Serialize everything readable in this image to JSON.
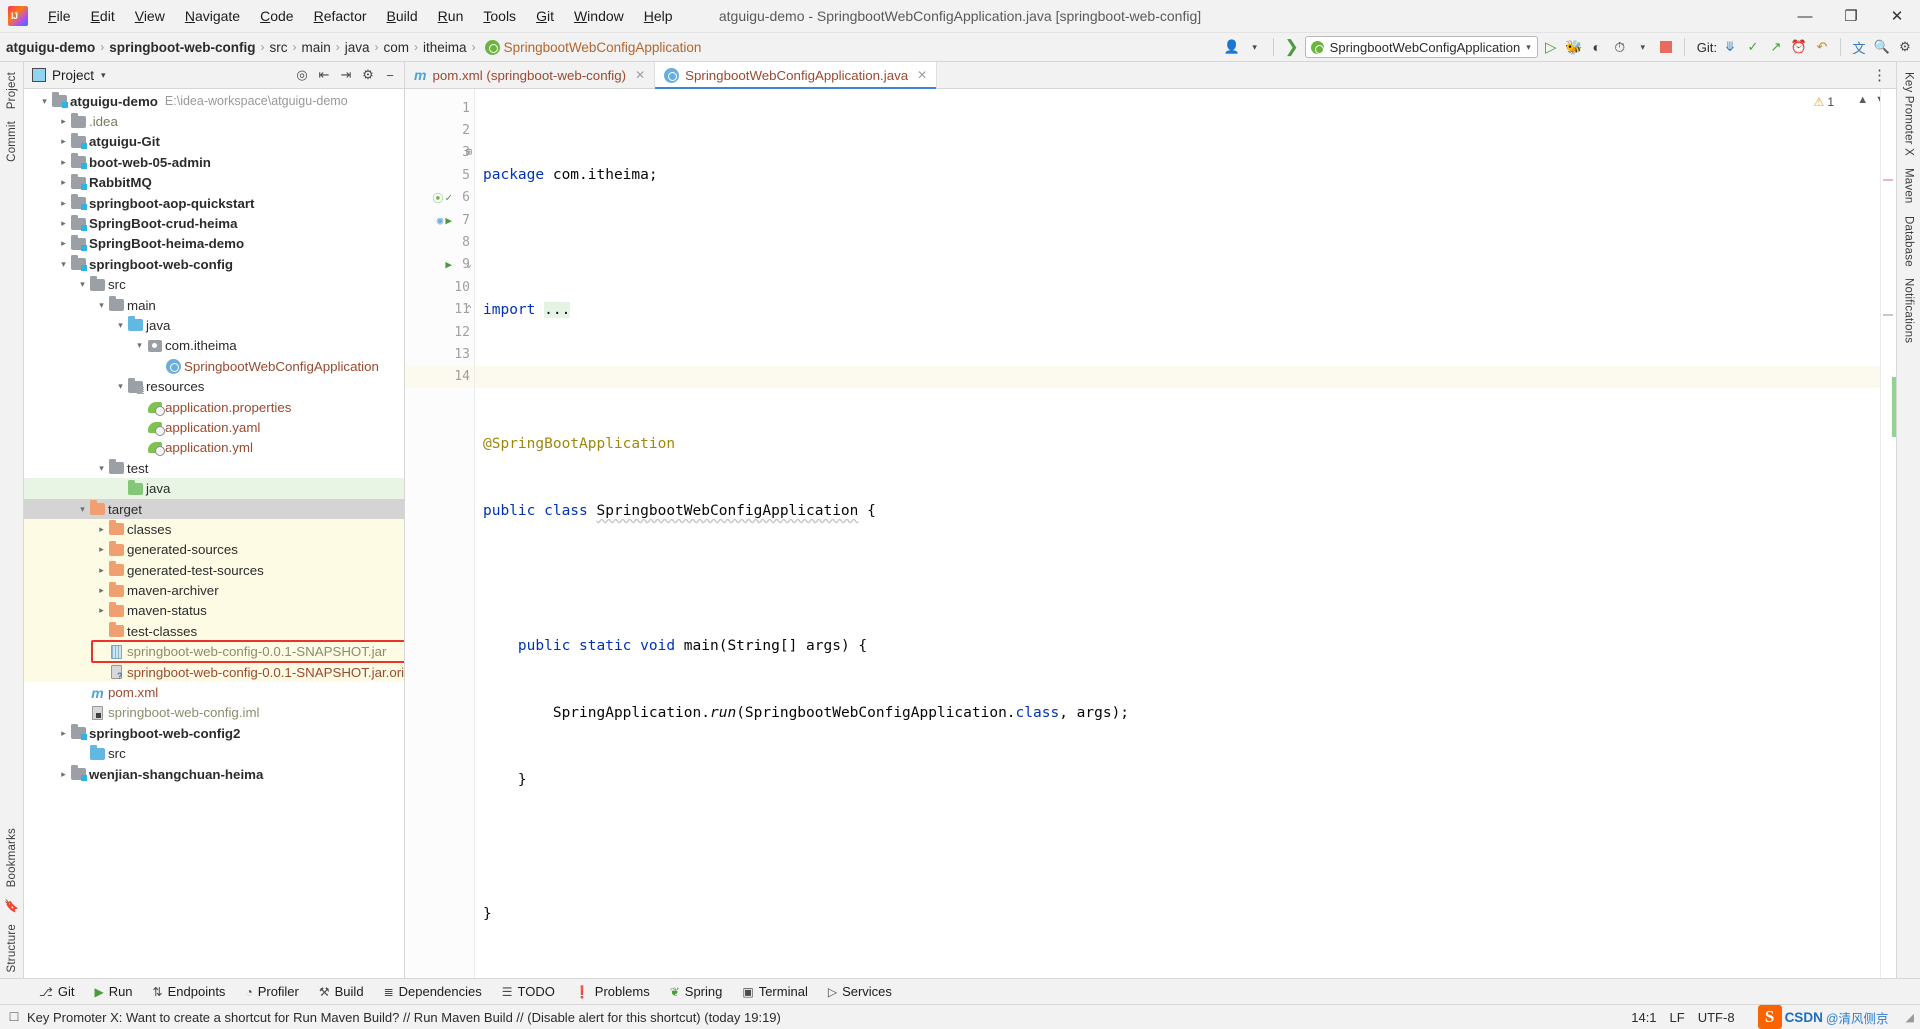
{
  "window": {
    "title": "atguigu-demo - SpringbootWebConfigApplication.java [springboot-web-config]",
    "minimize": "—",
    "maximize": "❐",
    "close": "✕",
    "logo_text": "IJ"
  },
  "menubar": {
    "items": [
      "File",
      "Edit",
      "View",
      "Navigate",
      "Code",
      "Refactor",
      "Build",
      "Run",
      "Tools",
      "Git",
      "Window",
      "Help"
    ]
  },
  "navbar": {
    "breadcrumbs": [
      {
        "label": "atguigu-demo",
        "style": "bold"
      },
      {
        "label": "springboot-web-config",
        "style": "bold"
      },
      {
        "label": "src",
        "style": "normal"
      },
      {
        "label": "main",
        "style": "normal"
      },
      {
        "label": "java",
        "style": "normal"
      },
      {
        "label": "com",
        "style": "normal"
      },
      {
        "label": "itheima",
        "style": "normal"
      },
      {
        "label": "SpringbootWebConfigApplication",
        "style": "link"
      }
    ],
    "separator": "›",
    "run_config": "SpringbootWebConfigApplication",
    "run_config_caret": "▾",
    "git_label": "Git:",
    "icons": {
      "user": "user-icon",
      "build_hammer": "hammer-icon",
      "run": "run-icon",
      "debug": "debug-icon",
      "run_coverage": "coverage-icon",
      "profile": "profiler-icon",
      "stop": "stop-icon",
      "update_project": "update-project-icon",
      "commit": "commit-icon",
      "push": "push-icon",
      "history": "history-icon",
      "rollback": "rollback-icon",
      "translate": "translate-icon",
      "search": "search-icon",
      "settings": "settings-icon"
    }
  },
  "left_rail": {
    "items": [
      "Project",
      "Commit",
      "Bookmarks",
      "Structure"
    ]
  },
  "right_rail": {
    "items": [
      "Key Promoter X",
      "Maven",
      "Database",
      "Notifications"
    ]
  },
  "project_panel": {
    "title": "Project",
    "caret": "▾",
    "actions": [
      "locate-icon",
      "expand-all-icon",
      "collapse-all-icon",
      "settings-icon",
      "hide-icon"
    ],
    "tree": [
      {
        "depth": 0,
        "arrow": "open",
        "icon": "module-folder",
        "label": "atguigu-demo",
        "bold": true,
        "sub": "E:\\idea-workspace\\atguigu-demo"
      },
      {
        "depth": 1,
        "arrow": "closed",
        "icon": "folder-gray",
        "label": ".idea",
        "color": "gray-text"
      },
      {
        "depth": 1,
        "arrow": "closed",
        "icon": "module-folder",
        "label": "atguigu-Git",
        "bold": true
      },
      {
        "depth": 1,
        "arrow": "closed",
        "icon": "module-folder",
        "label": "boot-web-05-admin",
        "bold": true
      },
      {
        "depth": 1,
        "arrow": "closed",
        "icon": "module-folder",
        "label": "RabbitMQ",
        "bold": true
      },
      {
        "depth": 1,
        "arrow": "closed",
        "icon": "module-folder",
        "label": "springboot-aop-quickstart",
        "bold": true
      },
      {
        "depth": 1,
        "arrow": "closed",
        "icon": "module-folder",
        "label": "SpringBoot-crud-heima",
        "bold": true
      },
      {
        "depth": 1,
        "arrow": "closed",
        "icon": "module-folder",
        "label": "SpringBoot-heima-demo",
        "bold": true
      },
      {
        "depth": 1,
        "arrow": "open",
        "icon": "module-folder",
        "label": "springboot-web-config",
        "bold": true
      },
      {
        "depth": 2,
        "arrow": "open",
        "icon": "folder-gray",
        "label": "src"
      },
      {
        "depth": 3,
        "arrow": "open",
        "icon": "folder-gray",
        "label": "main"
      },
      {
        "depth": 4,
        "arrow": "open",
        "icon": "folder-blue",
        "label": "java"
      },
      {
        "depth": 5,
        "arrow": "open",
        "icon": "package",
        "label": "com.itheima"
      },
      {
        "depth": 6,
        "arrow": "none",
        "icon": "spring-class",
        "label": "SpringbootWebConfigApplication",
        "color": "brown"
      },
      {
        "depth": 4,
        "arrow": "open",
        "icon": "folder-res",
        "label": "resources"
      },
      {
        "depth": 5,
        "arrow": "none",
        "icon": "spring-leaf",
        "label": "application.properties",
        "color": "brown"
      },
      {
        "depth": 5,
        "arrow": "none",
        "icon": "spring-leaf",
        "label": "application.yaml",
        "color": "brown"
      },
      {
        "depth": 5,
        "arrow": "none",
        "icon": "spring-leaf",
        "label": "application.yml",
        "color": "brown"
      },
      {
        "depth": 3,
        "arrow": "open",
        "icon": "folder-gray",
        "label": "test"
      },
      {
        "depth": 4,
        "arrow": "none",
        "icon": "folder-green",
        "label": "java",
        "bg": "green"
      },
      {
        "depth": 2,
        "arrow": "open",
        "icon": "folder-orange",
        "label": "target",
        "bg": "selected"
      },
      {
        "depth": 3,
        "arrow": "closed",
        "icon": "folder-orange",
        "label": "classes",
        "bg": "yellow"
      },
      {
        "depth": 3,
        "arrow": "closed",
        "icon": "folder-orange",
        "label": "generated-sources",
        "bg": "yellow"
      },
      {
        "depth": 3,
        "arrow": "closed",
        "icon": "folder-orange",
        "label": "generated-test-sources",
        "bg": "yellow"
      },
      {
        "depth": 3,
        "arrow": "closed",
        "icon": "folder-orange",
        "label": "maven-archiver",
        "bg": "yellow"
      },
      {
        "depth": 3,
        "arrow": "closed",
        "icon": "folder-orange",
        "label": "maven-status",
        "bg": "yellow"
      },
      {
        "depth": 3,
        "arrow": "none",
        "icon": "folder-orange",
        "label": "test-classes",
        "bg": "yellow"
      },
      {
        "depth": 3,
        "arrow": "none",
        "icon": "jar",
        "label": "springboot-web-config-0.0.1-SNAPSHOT.jar",
        "bg": "yellow",
        "color": "gray-olive",
        "highlight": true
      },
      {
        "depth": 3,
        "arrow": "none",
        "icon": "file-question",
        "label": "springboot-web-config-0.0.1-SNAPSHOT.jar.ori",
        "bg": "yellow",
        "color": "brown"
      },
      {
        "depth": 2,
        "arrow": "none",
        "icon": "maven-m",
        "label": "pom.xml",
        "color": "brown"
      },
      {
        "depth": 2,
        "arrow": "none",
        "icon": "iml",
        "label": "springboot-web-config.iml",
        "color": "gray-olive"
      },
      {
        "depth": 1,
        "arrow": "closed",
        "icon": "module-folder",
        "label": "springboot-web-config2",
        "bold": true
      },
      {
        "depth": 2,
        "arrow": "none",
        "icon": "folder-blue",
        "label": "src"
      },
      {
        "depth": 1,
        "arrow": "closed",
        "icon": "module-folder",
        "label": "wenjian-shangchuan-heima",
        "bold": true
      }
    ]
  },
  "editor": {
    "tabs": [
      {
        "label": "pom.xml (springboot-web-config)",
        "icon": "maven-m-icon",
        "active": false,
        "close": "✕"
      },
      {
        "label": "SpringbootWebConfigApplication.java",
        "icon": "spring-class-icon",
        "active": true,
        "close": "✕"
      }
    ],
    "kebab": "⋮",
    "warning_count": "1",
    "warning_icon": "⚠",
    "lines": [
      {
        "no": "1",
        "text": "package com.itheima;"
      },
      {
        "no": "2",
        "text": ""
      },
      {
        "no": "3",
        "text": "import ..."
      },
      {
        "no": "5",
        "text": ""
      },
      {
        "no": "6",
        "text": "@SpringBootApplication"
      },
      {
        "no": "7",
        "text": "public class SpringbootWebConfigApplication {"
      },
      {
        "no": "8",
        "text": ""
      },
      {
        "no": "9",
        "text": "    public static void main(String[] args) {"
      },
      {
        "no": "10",
        "text": "        SpringApplication.run(SpringbootWebConfigApplication.class, args);"
      },
      {
        "no": "11",
        "text": "    }"
      },
      {
        "no": "12",
        "text": ""
      },
      {
        "no": "13",
        "text": "}"
      },
      {
        "no": "14",
        "text": ""
      }
    ]
  },
  "bottom_tabs": [
    {
      "label": "Git",
      "icon": "git-branch-icon"
    },
    {
      "label": "Run",
      "icon": "run-icon"
    },
    {
      "label": "Endpoints",
      "icon": "endpoints-icon"
    },
    {
      "label": "Profiler",
      "icon": "profiler-icon"
    },
    {
      "label": "Build",
      "icon": "hammer-icon"
    },
    {
      "label": "Dependencies",
      "icon": "dependencies-icon"
    },
    {
      "label": "TODO",
      "icon": "todo-icon"
    },
    {
      "label": "Problems",
      "icon": "problems-icon"
    },
    {
      "label": "Spring",
      "icon": "spring-leaf-icon"
    },
    {
      "label": "Terminal",
      "icon": "terminal-icon"
    },
    {
      "label": "Services",
      "icon": "services-icon"
    }
  ],
  "statusbar": {
    "message": "Key Promoter X: Want to create a shortcut for Run Maven Build? // Run Maven Build // (Disable alert for this shortcut) (today 19:19)",
    "caret_position": "14:1",
    "line_separator": "LF",
    "encoding": "UTF-8",
    "watermark_logo": "S",
    "watermark_main": "CSDN",
    "watermark_sub": "@清风侧京"
  },
  "colors": {
    "accent_blue": "#3d87d6",
    "keyword_blue": "#0033b3",
    "annotation_gold": "#9e880d",
    "brown_file": "#9b4a2f",
    "orange_folder": "#f0a070",
    "highlight_red": "#e8342a",
    "selected_gray": "#d4d4d4",
    "yellow_bg": "#fdfbe4",
    "green_bg": "#e8f5e4"
  }
}
